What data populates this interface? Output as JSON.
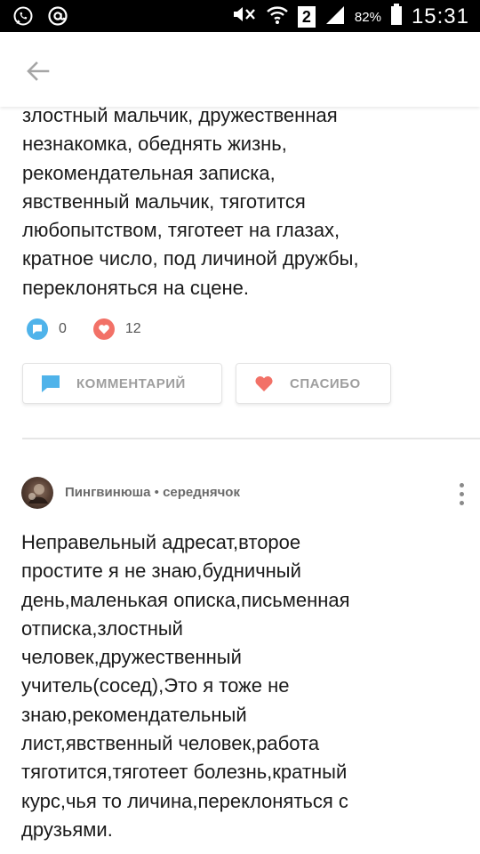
{
  "status_bar": {
    "left_icons": [
      "whatsapp-icon",
      "at-sign-icon"
    ],
    "sim_number": "2",
    "battery": "82%",
    "time": "15:31"
  },
  "app_bar": {
    "back_icon": "arrow-left-icon"
  },
  "answer1": {
    "lines": [
      "злостный мальчик, дружественная",
      "незнакомка, обеднять жизнь,",
      "рекомендательная записка,",
      "явственный мальчик, тяготится",
      "любопытством, тяготеет на глазах,",
      "кратное число, под личиной дружбы,",
      "переклоняться на сцене."
    ],
    "comments_count": "0",
    "likes_count": "12",
    "comment_button_label": "КОММЕНТАРИЙ",
    "thanks_button_label": "СПАСИБО",
    "colors": {
      "comment_accent": "#4fb3ea",
      "thanks_accent": "#f27167"
    }
  },
  "answer2": {
    "author_name": "Пингвинюша",
    "separator": " • ",
    "author_rank": "середнячок",
    "lines": [
      "Неправельный адресат,второе",
      "простите я не знаю,будничный",
      "день,маленькая описка,письменная",
      "отписка,злостный",
      "человек,дружественный",
      "учитель(сосед),Это я тоже не",
      "знаю,рекомендательный",
      "лист,явственный человек,работа",
      "тяготится,тяготеет болезнь,кратный",
      "курс,чья то личина,переклоняться с",
      "друзьями."
    ]
  }
}
